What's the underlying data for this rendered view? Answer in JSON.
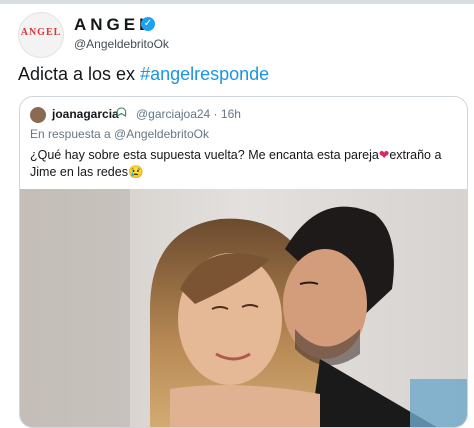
{
  "author": {
    "name": "ANGEL",
    "handle": "@AngeldebritoOk",
    "avatar_text": "ANGEL",
    "verified_icon": "✓"
  },
  "tweet": {
    "text_prefix": "Adicta a los ex ",
    "hashtag": "#angelresponde"
  },
  "quoted": {
    "name": "joanagarcia",
    "name_emoji": "ᗣ",
    "handle_time": "@garciajoa24 · 16h",
    "reply_to": "En respuesta a @AngeldebritoOk",
    "text_part1": "¿Qué hay sobre esta supuesta vuelta? Me encanta esta pareja",
    "heart": "❤",
    "text_part2": "extraño a Jime en las redes",
    "text_emoji": "😢"
  },
  "colors": {
    "link": "#1b95e0",
    "verified": "#1da1f2",
    "heart": "#e0245e"
  }
}
